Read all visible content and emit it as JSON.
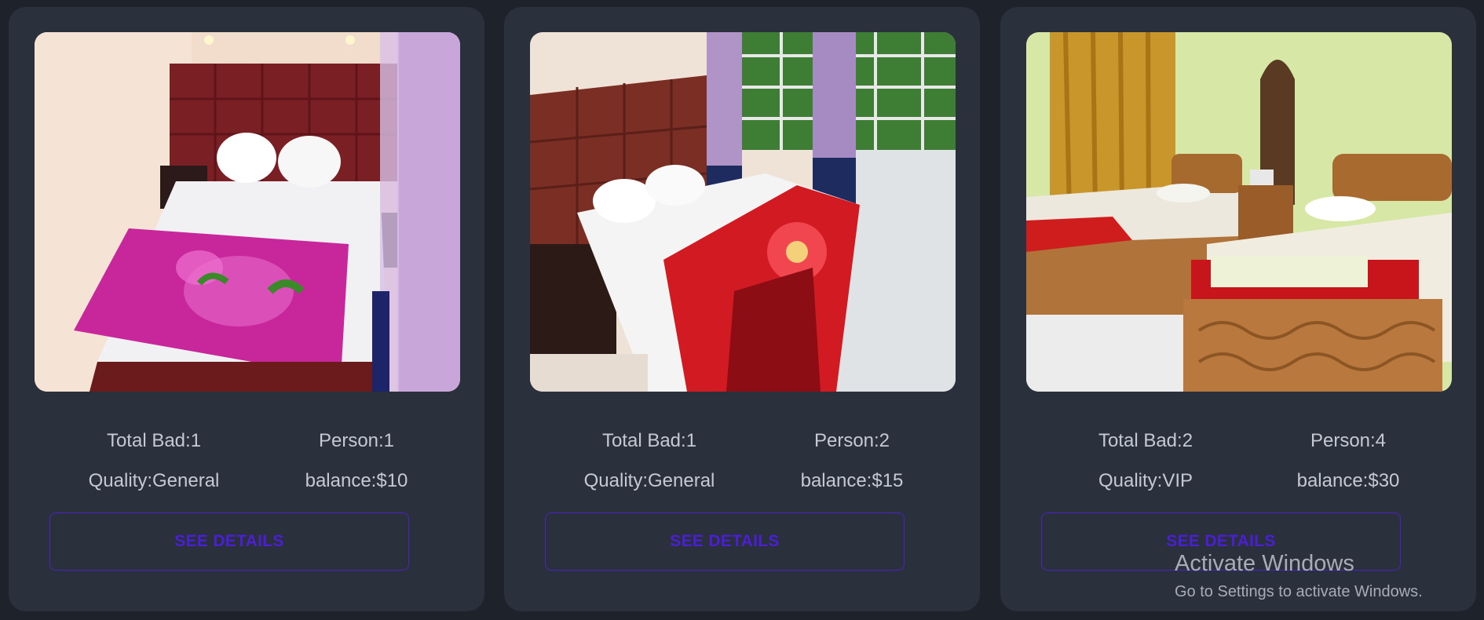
{
  "rooms": [
    {
      "total_bad": "Total Bad:1",
      "person": "Person:1",
      "quality": "Quality:General",
      "balance": "balance:$10",
      "button_label": "SEE DETAILS",
      "image_alt": "Room photo with pink floral blanket"
    },
    {
      "total_bad": "Total Bad:1",
      "person": "Person:2",
      "quality": "Quality:General",
      "balance": "balance:$15",
      "button_label": "SEE DETAILS",
      "image_alt": "Room photo with red blanket and window"
    },
    {
      "total_bad": "Total Bad:2",
      "person": "Person:4",
      "quality": "Quality:VIP",
      "balance": "balance:$30",
      "button_label": "SEE DETAILS",
      "image_alt": "Room photo with two wooden beds"
    }
  ],
  "watermark": {
    "title": "Activate Windows",
    "subtitle": "Go to Settings to activate Windows."
  },
  "colors": {
    "page_bg": "#1e222b",
    "card_bg": "#2a303c",
    "accent": "#4a1fd6",
    "text": "#c4c9d2"
  }
}
